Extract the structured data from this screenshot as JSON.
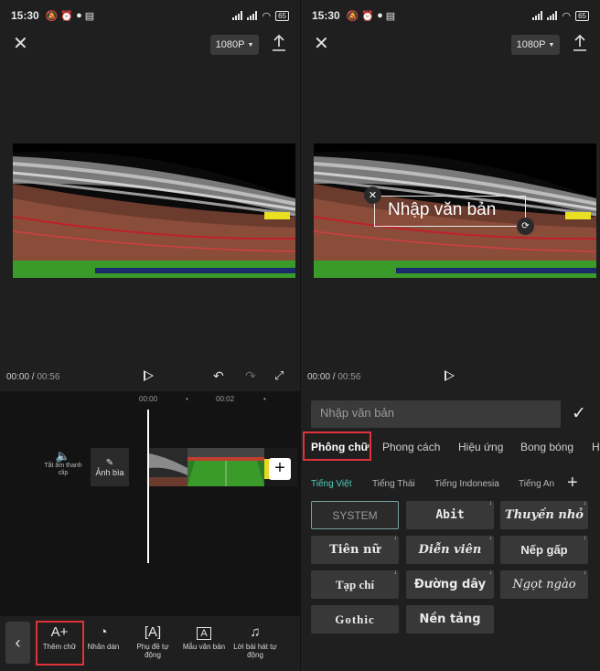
{
  "status_bar": {
    "time": "15:30",
    "battery": "65"
  },
  "top_bar": {
    "resolution": "1080P"
  },
  "playback": {
    "current_time": "00:00",
    "total_time": "00:56"
  },
  "timeline": {
    "ruler_marks": [
      "00:00",
      "00:02"
    ],
    "mute_label": "Tắt âm thanh clip",
    "cover_label": "Ảnh bìa"
  },
  "left_toolbar": {
    "tools": [
      {
        "icon": "A+",
        "label": "Thêm chữ"
      },
      {
        "icon": "sticker",
        "label": "Nhãn dán"
      },
      {
        "icon": "[A]",
        "label": "Phụ đề tự động"
      },
      {
        "icon": "A",
        "label": "Mẫu văn bản"
      },
      {
        "icon": "lyrics",
        "label": "Lời bài hát tự động"
      }
    ]
  },
  "overlay": {
    "text": "Nhập văn bản"
  },
  "editor": {
    "input_placeholder": "Nhập văn bản",
    "tabs": [
      "Phông chữ",
      "Phong cách",
      "Hiệu ứng",
      "Bong bóng",
      "H"
    ],
    "active_tab": "Phông chữ",
    "font_languages": [
      "Tiếng Việt",
      "Tiếng Thái",
      "Tiếng Indonesia",
      "Tiếng An"
    ],
    "fonts": [
      {
        "name": "SYSTEM",
        "selected": true,
        "download": false
      },
      {
        "name": "Abit",
        "selected": false,
        "download": true
      },
      {
        "name": "Thuyền nhỏ",
        "selected": false,
        "download": true
      },
      {
        "name": "Tiên nữ",
        "selected": false,
        "download": true
      },
      {
        "name": "Diễn viên",
        "selected": false,
        "download": true
      },
      {
        "name": "Nếp gấp",
        "selected": false,
        "download": true
      },
      {
        "name": "Tạp chí",
        "selected": false,
        "download": true
      },
      {
        "name": "Đường dây",
        "selected": false,
        "download": true
      },
      {
        "name": "Ngọt ngào",
        "selected": false,
        "download": true
      },
      {
        "name": "Gothic",
        "selected": false,
        "download": false
      },
      {
        "name": "Nền tảng",
        "selected": false,
        "download": false
      }
    ]
  },
  "colors": {
    "background": "#1f1f1f",
    "timeline_bg": "#131313",
    "highlight_red": "#e0323a",
    "accent_teal": "#4fd0c0"
  }
}
